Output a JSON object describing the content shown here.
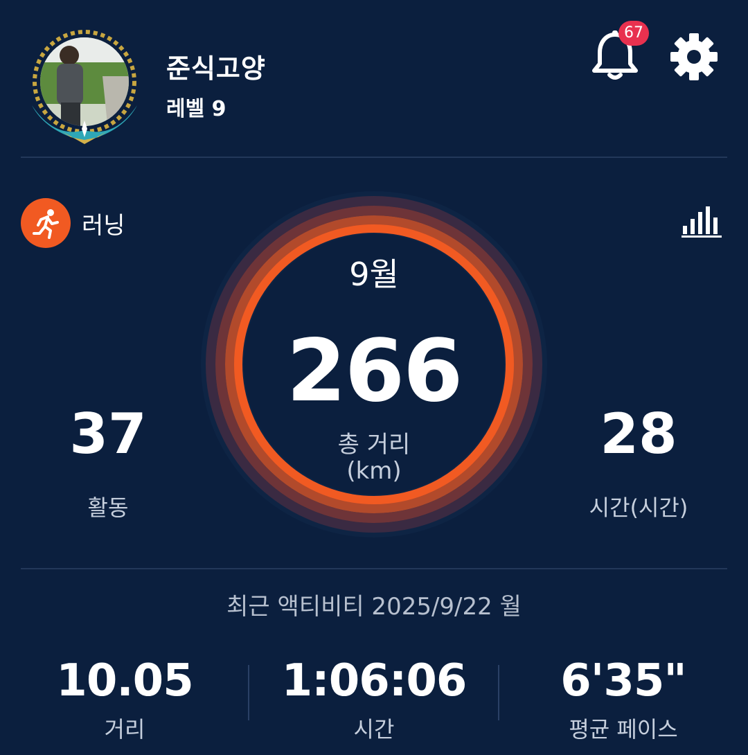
{
  "profile": {
    "name": "준식고양",
    "level": "레벨 9"
  },
  "header": {
    "notification_count": "67",
    "icons": [
      "bell-icon",
      "gear-icon"
    ]
  },
  "activity": {
    "type_label": "러닝",
    "icon": "running-person-icon"
  },
  "summary": {
    "period": "9월",
    "total_distance": "266",
    "total_distance_label": "총 거리",
    "total_distance_unit": "(km)",
    "activities_count": "37",
    "activities_label": "활동",
    "hours": "28",
    "hours_label": "시간(시간)"
  },
  "recent": {
    "title": "최근 액티비티 2025/9/22 월",
    "distance": "10.05",
    "distance_label": "거리",
    "time": "1:06:06",
    "time_label": "시간",
    "pace": "6'35\"",
    "pace_label": "평균 페이스"
  },
  "colors": {
    "background": "#0b1f3e",
    "accent": "#f15a22",
    "badge": "#e8314f"
  }
}
